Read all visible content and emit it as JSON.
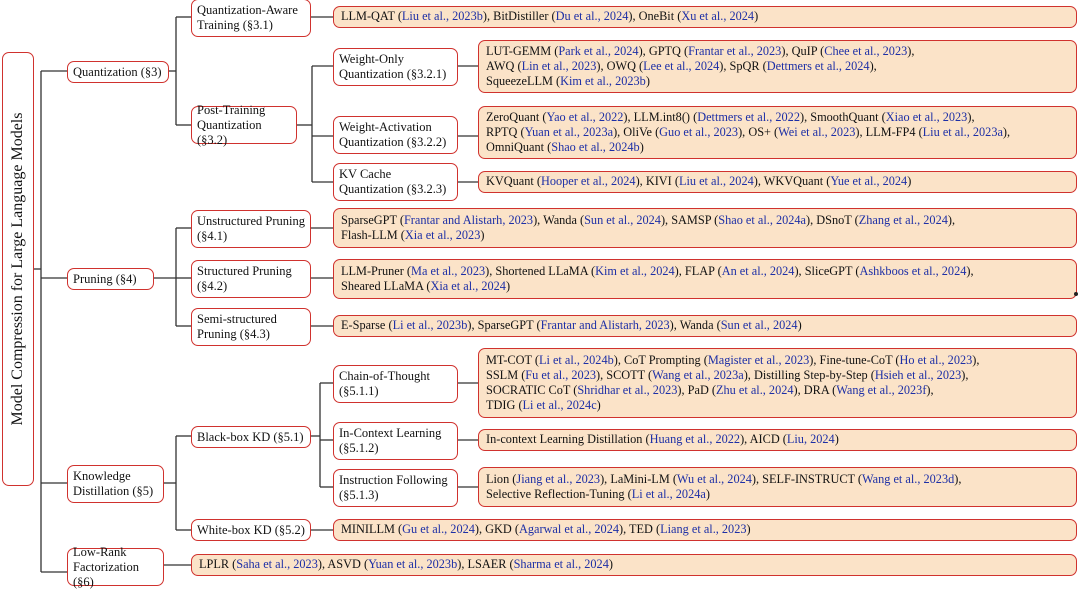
{
  "root": "Model Compression for Large Language Models",
  "categories": {
    "quantization": "Quantization (§3)",
    "pruning": "Pruning (§4)",
    "kd": "Knowledge Distillation (§5)",
    "lowrank": "Low-Rank Factorization (§6)"
  },
  "subcategories": {
    "qat": "Quantization-Aware Training (§3.1)",
    "ptq": "Post-Training Quantization (§3.2)",
    "wo": "Weight-Only Quantization (§3.2.1)",
    "wa": "Weight-Activation Quantization (§3.2.2)",
    "kv": "KV Cache Quantization (§3.2.3)",
    "unstructured": "Unstructured Pruning (§4.1)",
    "structured": "Structured Pruning (§4.2)",
    "semi": "Semi-structured Pruning (§4.3)",
    "blackbox": "Black-box KD (§5.1)",
    "whitebox": "White-box KD (§5.2)",
    "cot": "Chain-of-Thought (§5.1.1)",
    "icl": "In-Context Learning (§5.1.2)",
    "if": "Instruction Following (§5.1.3)"
  },
  "leaves": {
    "qat": [
      [
        "LLM-QAT (",
        ""
      ],
      [
        "Liu et al., 2023b",
        "ref"
      ],
      [
        "), BitDistiller (",
        ""
      ],
      [
        "Du et al., 2024",
        "ref"
      ],
      [
        "), OneBit (",
        ""
      ],
      [
        "Xu et al., 2024",
        "ref"
      ],
      [
        ")",
        ""
      ]
    ],
    "wo": [
      [
        "LUT-GEMM (",
        ""
      ],
      [
        "Park et al., 2024",
        "ref"
      ],
      [
        "), GPTQ (",
        ""
      ],
      [
        "Frantar et al., 2023",
        "ref"
      ],
      [
        "), QuIP (",
        ""
      ],
      [
        "Chee et al., 2023",
        "ref"
      ],
      [
        "),",
        ""
      ],
      [
        "\n",
        ""
      ],
      [
        "AWQ (",
        ""
      ],
      [
        "Lin et al., 2023",
        "ref"
      ],
      [
        "), OWQ (",
        ""
      ],
      [
        "Lee et al., 2024",
        "ref"
      ],
      [
        "), SpQR (",
        ""
      ],
      [
        "Dettmers et al., 2024",
        "ref"
      ],
      [
        "),",
        ""
      ],
      [
        "\n",
        ""
      ],
      [
        "SqueezeLLM (",
        ""
      ],
      [
        "Kim et al., 2023b",
        "ref"
      ],
      [
        ")",
        ""
      ]
    ],
    "wa": [
      [
        "ZeroQuant (",
        ""
      ],
      [
        "Yao et al., 2022",
        "ref"
      ],
      [
        "), LLM.int8() (",
        ""
      ],
      [
        "Dettmers et al., 2022",
        "ref"
      ],
      [
        "), SmoothQuant (",
        ""
      ],
      [
        "Xiao et al., 2023",
        "ref"
      ],
      [
        "),",
        ""
      ],
      [
        "\n",
        ""
      ],
      [
        "RPTQ (",
        ""
      ],
      [
        "Yuan et al., 2023a",
        "ref"
      ],
      [
        "), OliVe (",
        ""
      ],
      [
        "Guo et al., 2023",
        "ref"
      ],
      [
        "), OS+ (",
        ""
      ],
      [
        "Wei et al., 2023",
        "ref"
      ],
      [
        "), LLM-FP4 (",
        ""
      ],
      [
        "Liu et al., 2023a",
        "ref"
      ],
      [
        "),",
        ""
      ],
      [
        "\n",
        ""
      ],
      [
        "OmniQuant (",
        ""
      ],
      [
        "Shao et al., 2024b",
        "ref"
      ],
      [
        ")",
        ""
      ]
    ],
    "kv": [
      [
        "KVQuant (",
        ""
      ],
      [
        "Hooper et al., 2024",
        "ref"
      ],
      [
        "), KIVI (",
        ""
      ],
      [
        "Liu et al., 2024",
        "ref"
      ],
      [
        "), WKVQuant (",
        ""
      ],
      [
        "Yue et al., 2024",
        "ref"
      ],
      [
        ")",
        ""
      ]
    ],
    "unstructured": [
      [
        "SparseGPT (",
        ""
      ],
      [
        "Frantar and Alistarh, 2023",
        "ref"
      ],
      [
        "), Wanda (",
        ""
      ],
      [
        "Sun et al., 2024",
        "ref"
      ],
      [
        "), SAMSP (",
        ""
      ],
      [
        "Shao et al., 2024a",
        "ref"
      ],
      [
        "), DSnoT (",
        ""
      ],
      [
        "Zhang et al., 2024",
        "ref"
      ],
      [
        "),",
        ""
      ],
      [
        "\n",
        ""
      ],
      [
        "Flash-LLM (",
        ""
      ],
      [
        "Xia et al., 2023",
        "ref"
      ],
      [
        ")",
        ""
      ]
    ],
    "structured": [
      [
        "LLM-Pruner (",
        ""
      ],
      [
        "Ma et al., 2023",
        "ref"
      ],
      [
        "), Shortened LLaMA (",
        ""
      ],
      [
        "Kim et al., 2024",
        "ref"
      ],
      [
        "), FLAP (",
        ""
      ],
      [
        "An et al., 2024",
        "ref"
      ],
      [
        "), SliceGPT (",
        ""
      ],
      [
        "Ashkboos et al., 2024",
        "ref"
      ],
      [
        "),",
        ""
      ],
      [
        "\n",
        ""
      ],
      [
        "Sheared LLaMA (",
        ""
      ],
      [
        "Xia et al., 2024",
        "ref"
      ],
      [
        ")",
        ""
      ]
    ],
    "semi": [
      [
        "E-Sparse (",
        ""
      ],
      [
        "Li et al., 2023b",
        "ref"
      ],
      [
        "), SparseGPT (",
        ""
      ],
      [
        "Frantar and Alistarh, 2023",
        "ref"
      ],
      [
        "), Wanda (",
        ""
      ],
      [
        "Sun et al., 2024",
        "ref"
      ],
      [
        ")",
        ""
      ]
    ],
    "cot": [
      [
        "MT-COT (",
        ""
      ],
      [
        "Li et al., 2024b",
        "ref"
      ],
      [
        "), CoT Prompting (",
        ""
      ],
      [
        "Magister et al., 2023",
        "ref"
      ],
      [
        "), Fine-tune-CoT (",
        ""
      ],
      [
        "Ho et al., 2023",
        "ref"
      ],
      [
        "),",
        ""
      ],
      [
        "\n",
        ""
      ],
      [
        "SSLM (",
        ""
      ],
      [
        "Fu et al., 2023",
        "ref"
      ],
      [
        "), SCOTT (",
        ""
      ],
      [
        "Wang et al., 2023a",
        "ref"
      ],
      [
        "), Distilling Step-by-Step (",
        ""
      ],
      [
        "Hsieh et al., 2023",
        "ref"
      ],
      [
        "),",
        ""
      ],
      [
        "\n",
        ""
      ],
      [
        "SOCRATIC CoT (",
        ""
      ],
      [
        "Shridhar et al., 2023",
        "ref"
      ],
      [
        "), PaD (",
        ""
      ],
      [
        "Zhu et al., 2024",
        "ref"
      ],
      [
        "), DRA (",
        ""
      ],
      [
        "Wang et al., 2023f",
        "ref"
      ],
      [
        "),",
        ""
      ],
      [
        "\n",
        ""
      ],
      [
        "TDIG (",
        ""
      ],
      [
        "Li et al., 2024c",
        "ref"
      ],
      [
        ")",
        ""
      ]
    ],
    "icl": [
      [
        "In-context Learning Distillation (",
        ""
      ],
      [
        "Huang et al., 2022",
        "ref"
      ],
      [
        "), AICD (",
        ""
      ],
      [
        "Liu, 2024",
        "ref"
      ],
      [
        ")",
        ""
      ]
    ],
    "if": [
      [
        "Lion (",
        ""
      ],
      [
        "Jiang et al., 2023",
        "ref"
      ],
      [
        "), LaMini-LM (",
        ""
      ],
      [
        "Wu et al., 2024",
        "ref"
      ],
      [
        "), SELF-INSTRUCT (",
        ""
      ],
      [
        "Wang et al., 2023d",
        "ref"
      ],
      [
        "),",
        ""
      ],
      [
        "\n",
        ""
      ],
      [
        "Selective Reflection-Tuning (",
        ""
      ],
      [
        "Li et al., 2024a",
        "ref"
      ],
      [
        ")",
        ""
      ]
    ],
    "whitebox": [
      [
        "MINILLM (",
        ""
      ],
      [
        "Gu et al., 2024",
        "ref"
      ],
      [
        "), GKD (",
        ""
      ],
      [
        "Agarwal et al., 2024",
        "ref"
      ],
      [
        "), TED (",
        ""
      ],
      [
        "Liang et al., 2023",
        "ref"
      ],
      [
        ")",
        ""
      ]
    ],
    "lowrank": [
      [
        "LPLR (",
        ""
      ],
      [
        "Saha et al., 2023",
        "ref"
      ],
      [
        "), ASVD (",
        ""
      ],
      [
        "Yuan et al., 2023b",
        "ref"
      ],
      [
        "), LSAER (",
        ""
      ],
      [
        "Sharma et al., 2024",
        "ref"
      ],
      [
        ")",
        ""
      ]
    ]
  },
  "colors": {
    "border": "#d0322e",
    "leaf_fill": "#fbe3c8",
    "ref_text": "#1d2fa6"
  }
}
